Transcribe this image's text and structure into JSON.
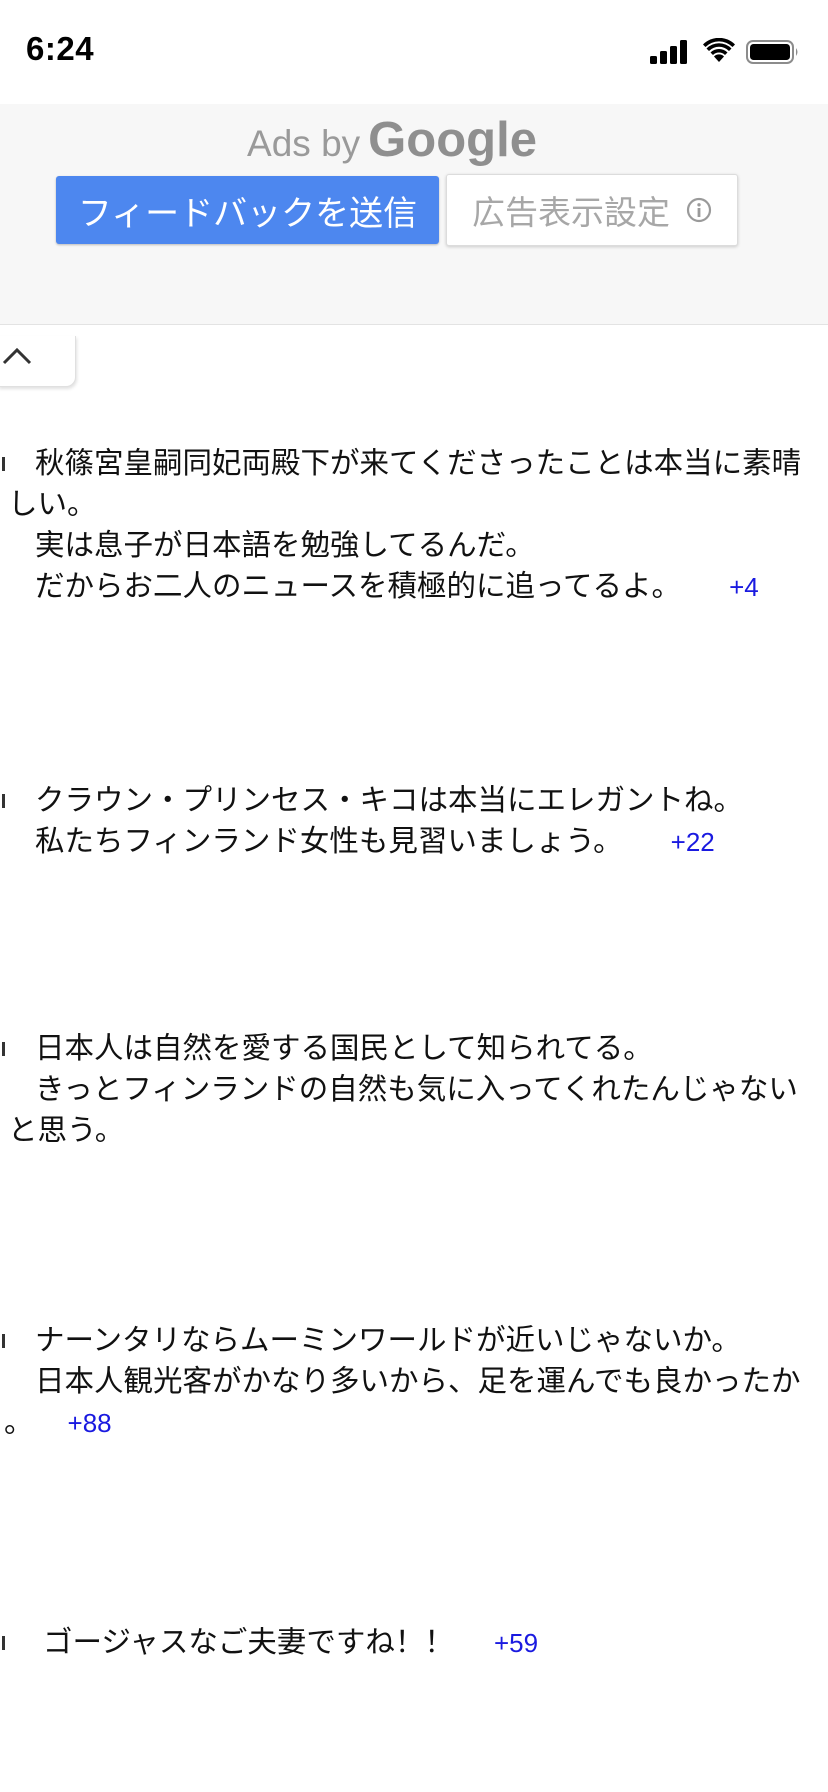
{
  "status_bar": {
    "time": "6:24"
  },
  "ad": {
    "ads_by": "Ads by",
    "brand": "Google",
    "feedback_button": "フィードバックを送信",
    "settings_button": "広告表示設定"
  },
  "comments": [
    {
      "lines": [
        "秋篠宮皇嗣同妃両殿下が来てくださったことは本当に素晴",
        "しい。",
        "実は息子が日本語を勉強してるんだ。",
        "だからお二人のニュースを積極的に追ってるよ。"
      ],
      "votes": "+4"
    },
    {
      "lines": [
        "クラウン・プリンセス・キコは本当にエレガントね。",
        "私たちフィンランド女性も見習いましょう。"
      ],
      "votes": "+22"
    },
    {
      "lines": [
        "日本人は自然を愛する国民として知られてる。",
        "きっとフィンランドの自然も気に入ってくれたんじゃない",
        "と思う。"
      ],
      "votes": ""
    },
    {
      "lines": [
        "ナーンタリならムーミンワールドが近いじゃないか。",
        "日本人観光客がかなり多いから、足を運んでも良かったか",
        "。"
      ],
      "votes": "+88"
    },
    {
      "lines": [
        "ゴージャスなご夫妻ですね！！"
      ],
      "votes": "+59"
    }
  ]
}
